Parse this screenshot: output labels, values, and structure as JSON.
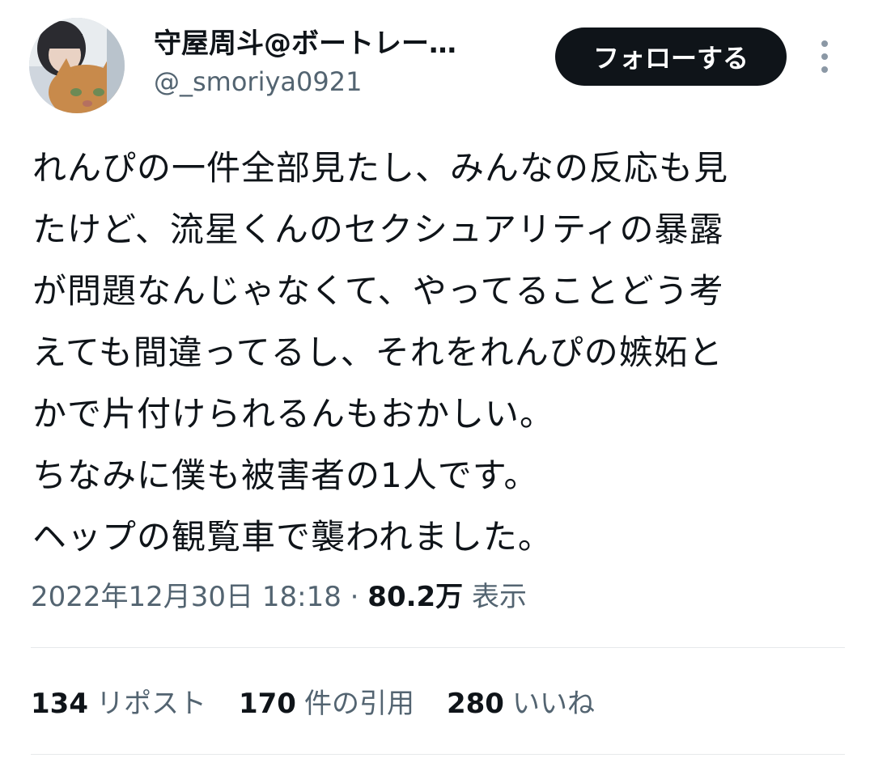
{
  "author": {
    "display_name": "守屋周斗@ボートレー…",
    "handle": "@_smoriya0921",
    "avatar_icon": "profile-photo-with-cat"
  },
  "follow_button": {
    "label": "フォローする"
  },
  "more_icon": "more-vertical-icon",
  "tweet": {
    "lines": [
      "れんぴの一件全部見たし、みんなの反応も見",
      "たけど、流星くんのセクシュアリティの暴露",
      "が問題なんじゃなくて、やってることどう考",
      "えても間違ってるし、それをれんぴの嫉妬と",
      "かで片付けられるんもおかしい。",
      "ちなみに僕も被害者の1人です。",
      "ヘップの観覧車で襲われました。"
    ]
  },
  "meta": {
    "timestamp": "2022年12月30日 18:18",
    "separator": "·",
    "views_count": "80.2万",
    "views_label": "表示"
  },
  "stats": {
    "reposts": {
      "count": "134",
      "label": "リポスト"
    },
    "quotes": {
      "count": "170",
      "label": "件の引用"
    },
    "likes": {
      "count": "280",
      "label": "いいね"
    }
  },
  "colors": {
    "text": "#0f1419",
    "secondary": "#536471",
    "button_bg": "#0f1419",
    "divider": "#e6e9eb"
  }
}
